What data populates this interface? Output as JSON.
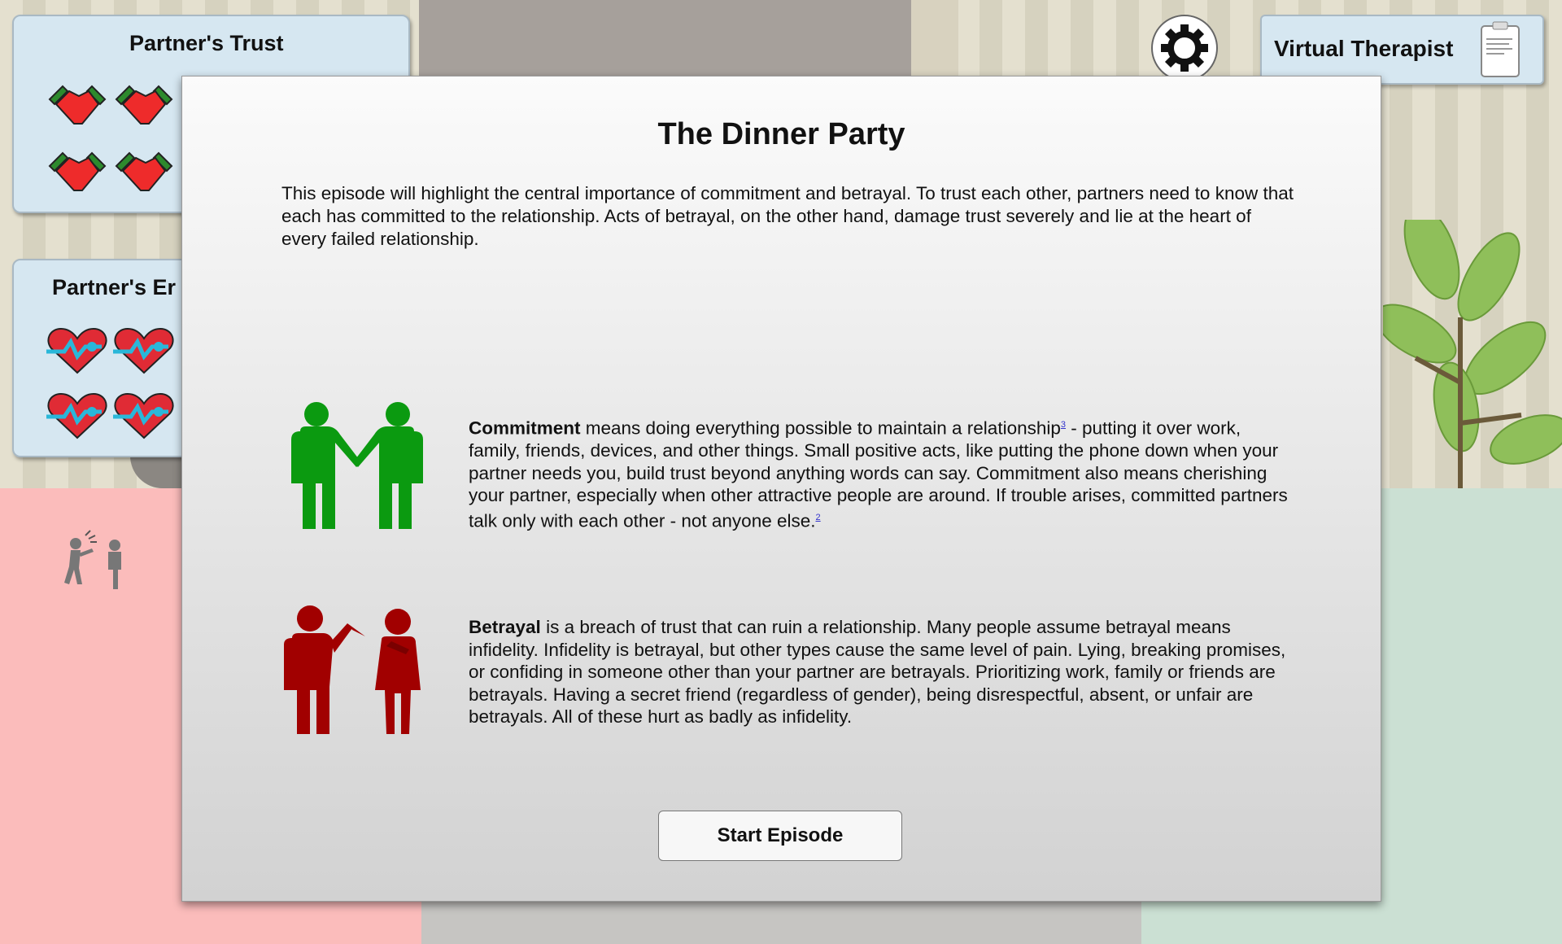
{
  "hud": {
    "trust_title": "Partner's Trust",
    "emotion_title": "Partner's Er",
    "therapist_label": "Virtual Therapist"
  },
  "icons": {
    "trust": "handshake-icon",
    "emotion": "heartbeat-icon",
    "settings": "gear-icon",
    "therapist": "clipboard-icon"
  },
  "modal": {
    "title": "The Dinner Party",
    "intro": "This episode will highlight the central importance of commitment and betrayal. To trust each other, partners need to know that each has committed to the relationship. Acts of betrayal, on the other hand, damage trust severely and lie at the heart of every failed relationship.",
    "commitment": {
      "term": "Commitment",
      "text_a": " means doing everything possible to maintain a relationship",
      "ref_a": "3",
      "text_b": " - putting it over work, family, friends, devices, and other things. Small positive acts, like putting the phone down when your partner needs you, build trust beyond anything words can say. Commitment also means cherishing your partner, especially when other attractive people are around. If trouble arises, committed partners talk only with each other - not anyone else.",
      "ref_b": "2"
    },
    "betrayal": {
      "term": "Betrayal",
      "text": " is a breach of trust that can ruin a relationship. Many people assume betrayal means infidelity. Infidelity is betrayal, but other types cause the same level of pain. Lying, breaking promises, or confiding in someone other than your partner are betrayals. Prioritizing work, family or friends are betrayals. Having a secret friend (regardless of gender), being disrespectful, absent, or unfair are betrayals. All of these hurt as badly as infidelity."
    },
    "start_button": "Start Episode"
  },
  "colors": {
    "commitment": "#0b9a10",
    "betrayal": "#a10000",
    "panel_bg": "#d6e7f1",
    "floor_left": "#fbbcbb",
    "floor_right": "#cbe0d3"
  }
}
